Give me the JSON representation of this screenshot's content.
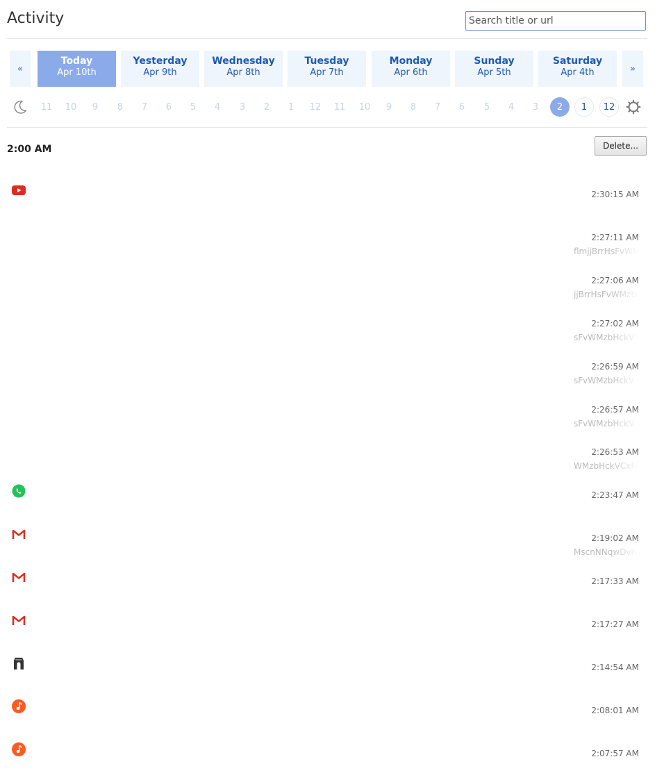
{
  "page_title": "Activity",
  "search": {
    "placeholder": "Search title or url"
  },
  "nav": {
    "prev_label": "«",
    "next_label": "»"
  },
  "days": [
    {
      "name": "Today",
      "date": "Apr 10th",
      "active": true
    },
    {
      "name": "Yesterday",
      "date": "Apr 9th",
      "active": false
    },
    {
      "name": "Wednesday",
      "date": "Apr 8th",
      "active": false
    },
    {
      "name": "Tuesday",
      "date": "Apr 7th",
      "active": false
    },
    {
      "name": "Monday",
      "date": "Apr 6th",
      "active": false
    },
    {
      "name": "Sunday",
      "date": "Apr 5th",
      "active": false
    },
    {
      "name": "Saturday",
      "date": "Apr 4th",
      "active": false
    }
  ],
  "hours": [
    {
      "label": "11",
      "state": "disabled"
    },
    {
      "label": "10",
      "state": "disabled"
    },
    {
      "label": "9",
      "state": "disabled"
    },
    {
      "label": "8",
      "state": "disabled"
    },
    {
      "label": "7",
      "state": "disabled"
    },
    {
      "label": "6",
      "state": "disabled"
    },
    {
      "label": "5",
      "state": "disabled"
    },
    {
      "label": "4",
      "state": "disabled"
    },
    {
      "label": "3",
      "state": "disabled"
    },
    {
      "label": "2",
      "state": "disabled"
    },
    {
      "label": "1",
      "state": "disabled"
    },
    {
      "label": "12",
      "state": "disabled"
    },
    {
      "label": "11",
      "state": "disabled"
    },
    {
      "label": "10",
      "state": "disabled"
    },
    {
      "label": "9",
      "state": "disabled"
    },
    {
      "label": "8",
      "state": "disabled"
    },
    {
      "label": "7",
      "state": "disabled"
    },
    {
      "label": "6",
      "state": "disabled"
    },
    {
      "label": "5",
      "state": "disabled"
    },
    {
      "label": "4",
      "state": "disabled"
    },
    {
      "label": "3",
      "state": "disabled"
    },
    {
      "label": "2",
      "state": "selected"
    },
    {
      "label": "1",
      "state": "enabled"
    },
    {
      "label": "12",
      "state": "enabled"
    }
  ],
  "section": {
    "time": "2:00 AM",
    "delete_label": "Delete..."
  },
  "colors": {
    "accent": "#8aaaea",
    "day_bg": "#eef5fc",
    "link": "#1f5ab0"
  },
  "entries": [
    {
      "icon": "youtube-icon",
      "time": "2:30:15 AM",
      "url": ""
    },
    {
      "icon": "",
      "time": "2:27:11 AM",
      "url": "flmjjBrrHsFvWM"
    },
    {
      "icon": "",
      "time": "2:27:06 AM",
      "url": "jjBrrHsFvWMzbH"
    },
    {
      "icon": "",
      "time": "2:27:02 AM",
      "url": "sFvWMzbHckV"
    },
    {
      "icon": "",
      "time": "2:26:59 AM",
      "url": "sFvWMzbHckV"
    },
    {
      "icon": "",
      "time": "2:26:57 AM",
      "url": "sFvWMzbHckV"
    },
    {
      "icon": "",
      "time": "2:26:53 AM",
      "url": "WMzbHckVCxM"
    },
    {
      "icon": "whatsapp-icon",
      "time": "2:23:47 AM",
      "url": ""
    },
    {
      "icon": "gmail-icon",
      "time": "2:19:02 AM",
      "url": "MscnNNqwDvh"
    },
    {
      "icon": "gmail-icon",
      "time": "2:17:33 AM",
      "url": ""
    },
    {
      "icon": "gmail-icon",
      "time": "2:17:27 AM",
      "url": ""
    },
    {
      "icon": "arch-icon",
      "time": "2:14:54 AM",
      "url": ""
    },
    {
      "icon": "music-icon",
      "time": "2:08:01 AM",
      "url": ""
    },
    {
      "icon": "music-icon",
      "time": "2:07:57 AM",
      "url": ""
    }
  ]
}
